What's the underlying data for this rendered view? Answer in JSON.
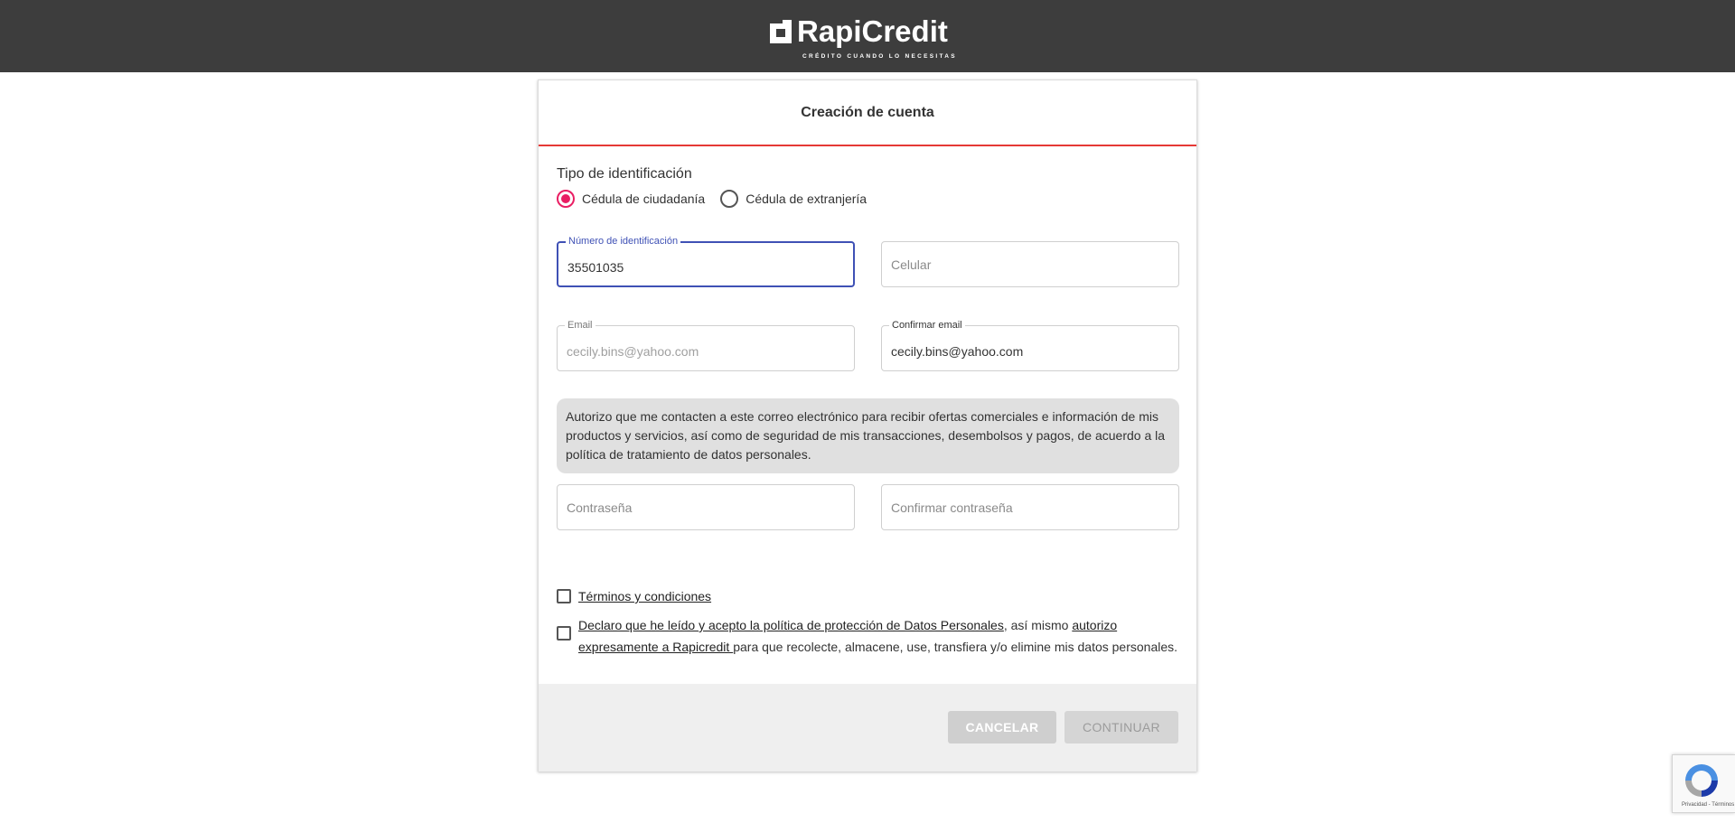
{
  "brand": {
    "name": "RapiCredit",
    "tagline": "CRÉDITO CUANDO LO NECESITAS",
    "accent": "#e53935",
    "radio_color": "#e91e63",
    "focus_color": "#3f51b5"
  },
  "form": {
    "title": "Creación de cuenta",
    "id_type_label": "Tipo de identificación",
    "id_types": [
      {
        "label": "Cédula de ciudadanía",
        "checked": true
      },
      {
        "label": "Cédula de extranjería",
        "checked": false
      }
    ],
    "id_number": {
      "label": "Número de identificación",
      "value": "35501035"
    },
    "phone": {
      "placeholder": "Celular",
      "value": ""
    },
    "email": {
      "label": "Email",
      "value": "cecily.bins@yahoo.com"
    },
    "confirm_email": {
      "label": "Confirmar email",
      "value": "cecily.bins@yahoo.com"
    },
    "notice": "Autorizo que me contacten a este correo electrónico para recibir ofertas comerciales e información de mis productos y servicios, así como de seguridad de mis transacciones, desembolsos y pagos, de acuerdo a la política de tratamiento de datos personales.",
    "password": {
      "placeholder": "Contraseña",
      "value": ""
    },
    "confirm_password": {
      "placeholder": "Confirmar contraseña",
      "value": ""
    },
    "terms_link": "Términos y condiciones",
    "privacy_link": "Declaro que he leído y acepto la política de protección de Datos Personales",
    "privacy_mid": ", así mismo ",
    "authorize_link": "autorizo expresamente a Rapicredit ",
    "privacy_end": "para que recolecte, almacene, use, transfiera y/o elimine mis datos personales.",
    "cancel_label": "CANCELAR",
    "continue_label": "CONTINUAR"
  },
  "recaptcha": {
    "text": "Privacidad - Términos"
  }
}
